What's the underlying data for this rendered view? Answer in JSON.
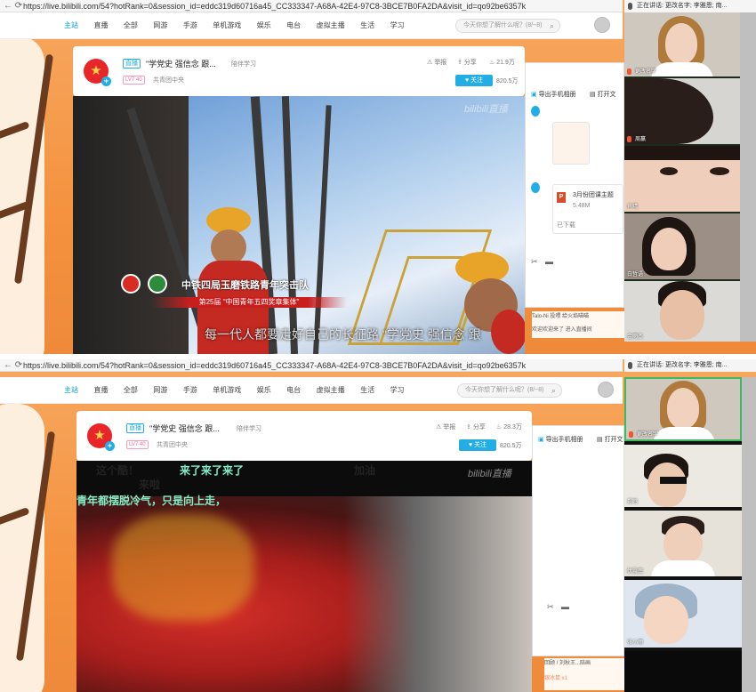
{
  "browser": {
    "url": "https://live.bilibili.com/54?hotRank=0&session_id=eddc319d60716a45_CC333347-A68A-42E4-97C8-3BCE7B0FA2DA&visit_id=qo92be6357k"
  },
  "navbar": {
    "items": [
      "主站",
      "直播",
      "全部",
      "网游",
      "手游",
      "单机游戏",
      "娱乐",
      "电台",
      "虚拟主播",
      "生活",
      "学习"
    ],
    "search_placeholder": "今天你想了解什么呢？(8/~8)"
  },
  "room": {
    "live_badge": "直播",
    "title_top": "\"学党史 强信念 跟...",
    "title_bottom": "\"学党史 强信念 跟...",
    "category": "陪伴学习",
    "level": "LV7 40",
    "host": "共青团中央",
    "report_label": "举报",
    "share_label": "分享",
    "popularity_top": "21.9万",
    "popularity_bottom": "28.3万",
    "follow_label": "关注",
    "followers": "820.5万"
  },
  "video_top": {
    "org_caption": "中铁四局玉磨铁路青年突击队",
    "award_caption": "第25届 \"中国青年五四奖章集体\"",
    "subtitle": "每一代人都要走好自己的长征路 \"学党史 强信念 跟",
    "watermark": "bilibili直播"
  },
  "video_bottom": {
    "danmaku": [
      {
        "text": "这个酷！",
        "color": "#ffffff"
      },
      {
        "text": "来了来了来了",
        "color": "#7ff0c8"
      },
      {
        "text": "加油",
        "color": "#ffffff"
      },
      {
        "text": "来啦",
        "color": "#ffffff"
      },
      {
        "text": "青年都摆脱冷气，只是向上走，",
        "color": "#7ff0c8"
      }
    ],
    "watermark": "bilibili直播"
  },
  "side_panel": {
    "export_label": "导出手机相册",
    "open_label": "打开文",
    "file_name": "3月份团课主题",
    "file_size": "5.48M",
    "file_status": "已下载",
    "chat_top_1": "Talo-Ni 投喂 给火焰喵喵",
    "chat_top_2": "欢迎欢迎来了 进入直播间",
    "chat_bottom_1": "回顾 / 刘秋王...陪画",
    "chat_bottom_2": "银冰鼠 x1"
  },
  "call": {
    "speaking_label": "正在讲话: 更改名字; 李雅恩; 南...",
    "speaking_label_bottom": "正在讲话: 更改名字; 李雅恩; 南...",
    "top_tiles": [
      "更改名字",
      "周赢",
      "肖晴",
      "白哲语",
      "金雨杰"
    ],
    "bottom_tiles": [
      "更改名字",
      "郑鸣",
      "伏震南",
      "张小雨"
    ]
  },
  "colors": {
    "accent": "#23ade5",
    "brand_red": "#e8262a",
    "backdrop": "#f4a25a"
  }
}
